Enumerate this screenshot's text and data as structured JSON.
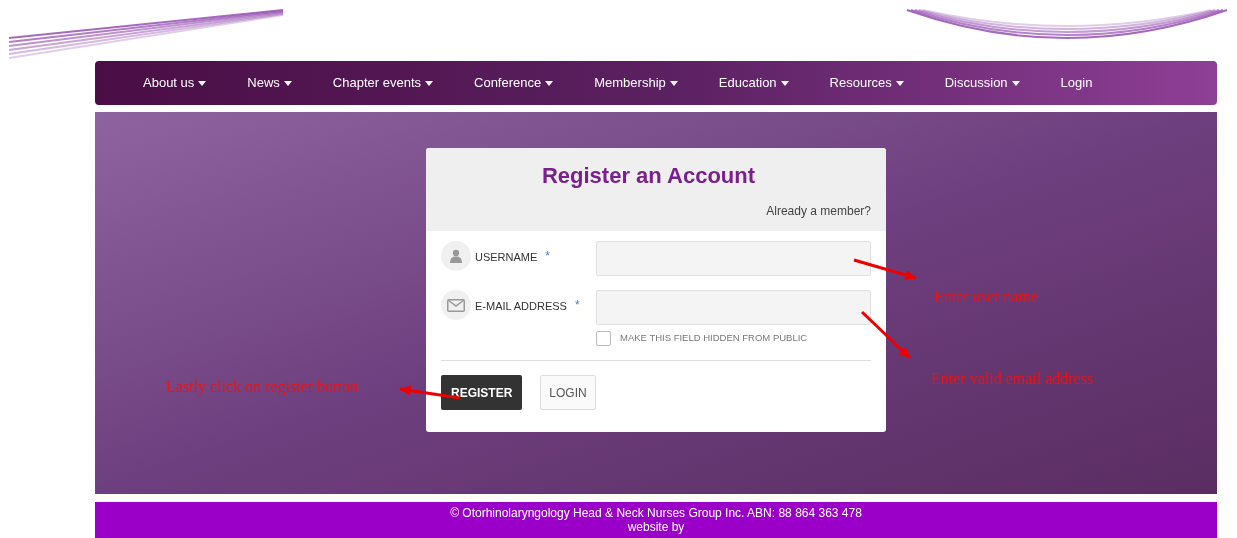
{
  "nav": {
    "items": [
      {
        "label": "About us",
        "dropdown": true
      },
      {
        "label": "News",
        "dropdown": true
      },
      {
        "label": "Chapter events",
        "dropdown": true
      },
      {
        "label": "Conference",
        "dropdown": true
      },
      {
        "label": "Membership",
        "dropdown": true
      },
      {
        "label": "Education",
        "dropdown": true
      },
      {
        "label": "Resources",
        "dropdown": true
      },
      {
        "label": "Discussion",
        "dropdown": true
      },
      {
        "label": "Login",
        "dropdown": false
      }
    ]
  },
  "form": {
    "title": "Register an Account",
    "member_link": "Already a member?",
    "fields": [
      {
        "kind": "user",
        "label": "USERNAME",
        "required_mark": "*"
      },
      {
        "kind": "mail",
        "label": "E-MAIL ADDRESS",
        "required_mark": "*",
        "hide_option": {
          "label": "MAKE THIS FIELD HIDDEN FROM PUBLIC",
          "checked": false
        }
      }
    ],
    "buttons": [
      {
        "label": "REGISTER",
        "kind": "primary"
      },
      {
        "label": "LOGIN",
        "kind": "secondary"
      }
    ]
  },
  "annotations": [
    "Enter user name",
    "Enter valid email address",
    "Lastly click on register button"
  ],
  "footer": {
    "lines": [
      "© Otorhinolaryngology Head & Neck Nurses Group Inc. ABN: 88 864 363 478",
      "website by"
    ]
  }
}
